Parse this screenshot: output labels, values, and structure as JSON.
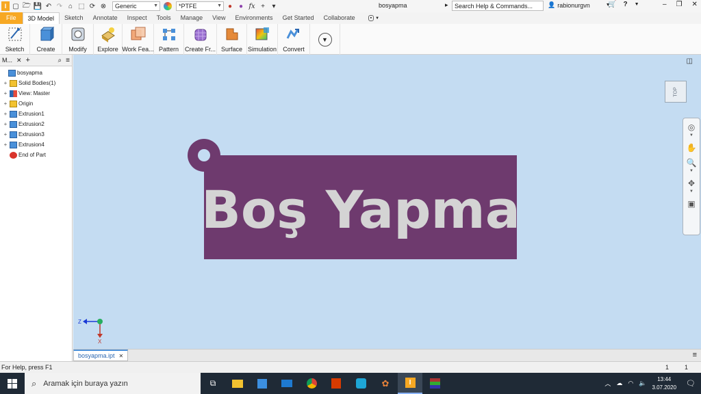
{
  "titlebar": {
    "appearance": "Generic",
    "material": "*PTFE",
    "document_title": "bosyapma",
    "search_placeholder": "Search Help & Commands...",
    "user": "rabionurgvn"
  },
  "tabs": [
    {
      "label": "File"
    },
    {
      "label": "3D Model"
    },
    {
      "label": "Sketch"
    },
    {
      "label": "Annotate"
    },
    {
      "label": "Inspect"
    },
    {
      "label": "Tools"
    },
    {
      "label": "Manage"
    },
    {
      "label": "View"
    },
    {
      "label": "Environments"
    },
    {
      "label": "Get Started"
    },
    {
      "label": "Collaborate"
    }
  ],
  "ribbon": [
    {
      "label": "Sketch",
      "icon": "sketch-icon"
    },
    {
      "label": "Create",
      "icon": "create-icon"
    },
    {
      "label": "Modify",
      "icon": "modify-icon"
    },
    {
      "label": "Explore",
      "icon": "explore-icon"
    },
    {
      "label": "Work Fea...",
      "icon": "work-features-icon"
    },
    {
      "label": "Pattern",
      "icon": "pattern-icon"
    },
    {
      "label": "Create Fr...",
      "icon": "create-freeform-icon"
    },
    {
      "label": "Surface",
      "icon": "surface-icon"
    },
    {
      "label": "Simulation",
      "icon": "simulation-icon"
    },
    {
      "label": "Convert",
      "icon": "convert-icon"
    }
  ],
  "browser": {
    "title": "M...",
    "tree": [
      {
        "label": "bosyapma",
        "icon": "part-icon",
        "expander": ""
      },
      {
        "label": "Solid Bodies(1)",
        "icon": "folder-icon",
        "expander": "+"
      },
      {
        "label": "View: Master",
        "icon": "view-icon",
        "expander": "+"
      },
      {
        "label": "Origin",
        "icon": "folder-icon",
        "expander": "+"
      },
      {
        "label": "Extrusion1",
        "icon": "extrusion-icon",
        "expander": "+"
      },
      {
        "label": "Extrusion2",
        "icon": "extrusion-icon",
        "expander": "+"
      },
      {
        "label": "Extrusion3",
        "icon": "extrusion-icon",
        "expander": "+"
      },
      {
        "label": "Extrusion4",
        "icon": "extrusion-icon",
        "expander": "+"
      },
      {
        "label": "End of Part",
        "icon": "end-of-part-icon",
        "expander": ""
      }
    ]
  },
  "model": {
    "text": "Boş Yapma",
    "plate_color": "#6e3a6e",
    "text_color": "#d4d4d4"
  },
  "viewcube": {
    "face": "TOP"
  },
  "triad": {
    "z": "Z",
    "x": "X"
  },
  "doc_tab": {
    "label": "bosyapma.ipt",
    "close": "✕"
  },
  "status": {
    "help": "For Help, press F1",
    "count1": "1",
    "count2": "1"
  },
  "taskbar": {
    "search_placeholder": "Aramak için buraya yazın",
    "time": "13:44",
    "date": "3.07.2020"
  }
}
